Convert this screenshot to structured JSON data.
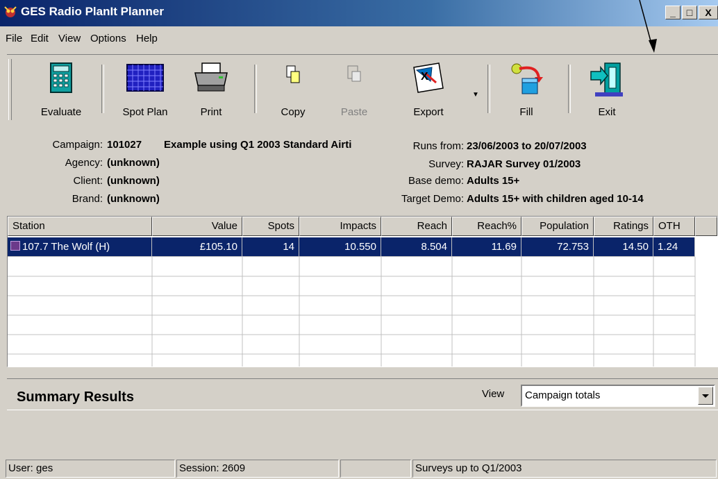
{
  "window": {
    "title": "GES Radio PlanIt Planner",
    "controls": [
      "_",
      "□",
      "X"
    ]
  },
  "menu": [
    {
      "label": "File"
    },
    {
      "label": "Edit"
    },
    {
      "label": "View"
    },
    {
      "label": "Options"
    },
    {
      "label": "Help"
    }
  ],
  "toolbar": {
    "evaluate": "Evaluate",
    "spot_plan": "Spot Plan",
    "print": "Print",
    "copy": "Copy",
    "paste": "Paste",
    "export": "Export",
    "fill": "Fill",
    "exit": "Exit"
  },
  "campaign": {
    "campaign_label": "Campaign:",
    "campaign_value": "101027",
    "campaign_desc": "Example using Q1 2003 Standard Airti",
    "agency_label": "Agency:",
    "agency_value": "(unknown)",
    "client_label": "Client:",
    "client_value": "(unknown)",
    "brand_label": "Brand:",
    "brand_value": "(unknown)",
    "runs_label": "Runs from:",
    "runs_value": "23/06/2003 to 20/07/2003",
    "survey_label": "Survey:",
    "survey_value": "RAJAR Survey 01/2003",
    "base_label": "Base demo:",
    "base_value": "Adults 15+",
    "target_label": "Target Demo:",
    "target_value": "Adults 15+ with children aged 10-14"
  },
  "table": {
    "columns": [
      "Station",
      "Value",
      "Spots",
      "Impacts",
      "Reach",
      "Reach%",
      "Population",
      "Ratings",
      "OTH"
    ],
    "rows": [
      {
        "station": "107.7 The Wolf (H)",
        "value": "£105.10",
        "spots": "14",
        "impacts": "10.550",
        "reach": "8.504",
        "reach_pct": "11.69",
        "population": "72.753",
        "ratings": "14.50",
        "oth": "1.24"
      }
    ]
  },
  "summary": {
    "title": "Summary Results",
    "view_label": "View",
    "view_value": "Campaign totals"
  },
  "status": {
    "user": "User: ges",
    "session": "Session: 2609",
    "empty": "",
    "surveys": "Surveys up to Q1/2003"
  },
  "colors": {
    "selection": "#0a246a",
    "face": "#d4d0c8"
  }
}
